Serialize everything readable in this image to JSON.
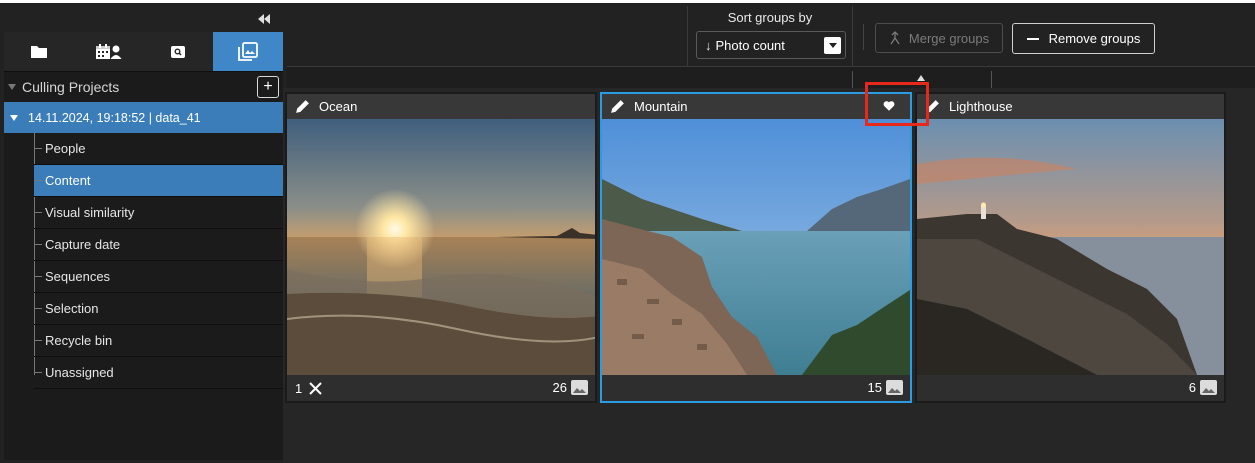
{
  "sidebar": {
    "collapse_icon": "double-chevron-left-icon",
    "mode_tabs": [
      {
        "icon": "folder-icon",
        "active": false
      },
      {
        "icon": "calendar-person-icon",
        "active": false
      },
      {
        "icon": "search-image-icon",
        "active": false
      },
      {
        "icon": "photo-stack-icon",
        "active": true
      }
    ],
    "projects_title": "Culling Projects",
    "add_label": "+",
    "project": "14.11.2024, 19:18:52 | data_41",
    "tree_items": [
      {
        "label": "People"
      },
      {
        "label": "Content",
        "active": true
      },
      {
        "label": "Visual similarity"
      },
      {
        "label": "Capture date"
      },
      {
        "label": "Sequences"
      },
      {
        "label": "Selection"
      },
      {
        "label": "Recycle bin"
      },
      {
        "label": "Unassigned"
      }
    ]
  },
  "toolbar": {
    "sort_title": "Sort groups by",
    "sort_arrow": "↓",
    "sort_value": "Photo count",
    "merge_label": "Merge groups",
    "remove_label": "Remove groups"
  },
  "groups": [
    {
      "title": "Ocean",
      "reject_count": "1",
      "photo_count": "26"
    },
    {
      "title": "Mountain",
      "reject_count": "",
      "photo_count": "15",
      "selected": true
    },
    {
      "title": "Lighthouse",
      "reject_count": "",
      "photo_count": "6"
    }
  ],
  "colors": {
    "accent": "#3a7db9",
    "selection_border": "#2b9be4",
    "highlight": "#e8281b"
  }
}
